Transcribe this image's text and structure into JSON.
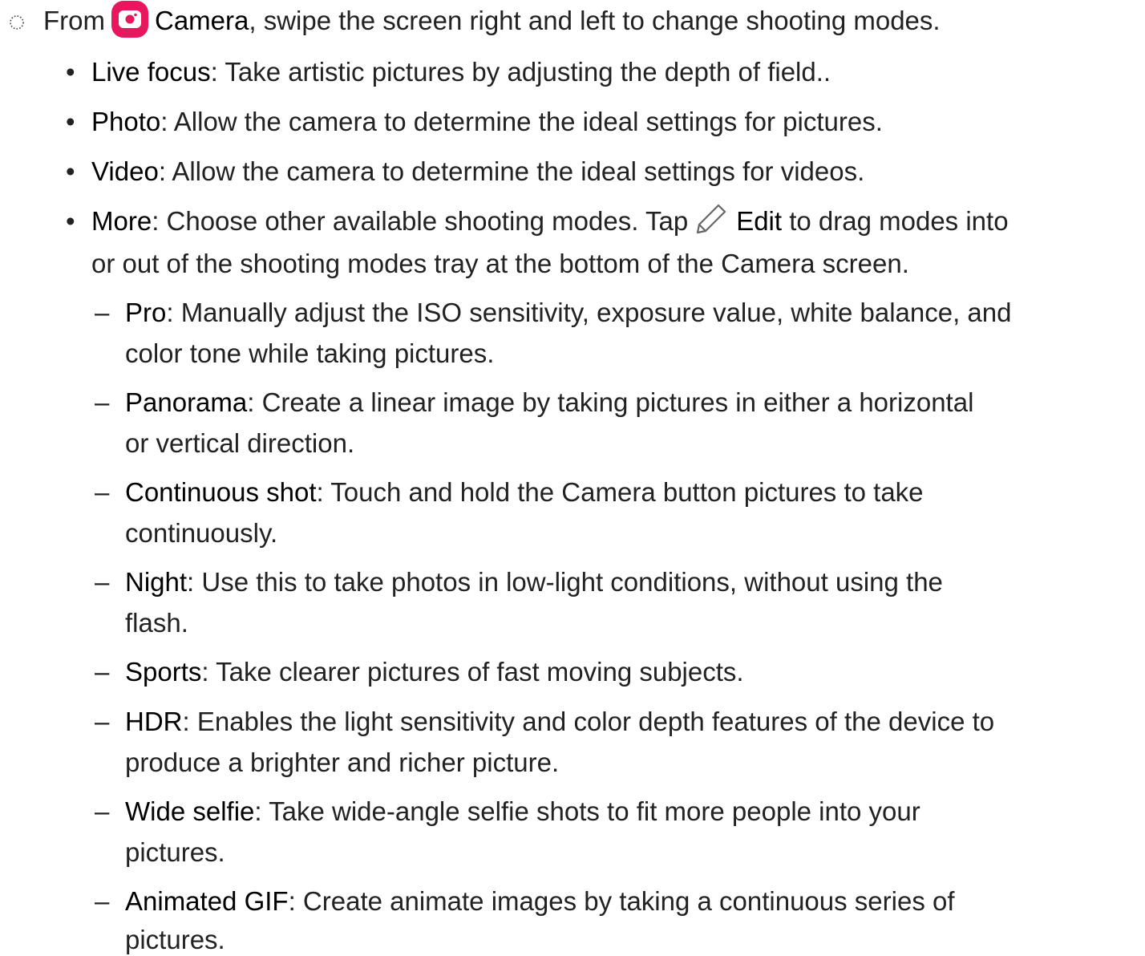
{
  "step": {
    "prefix": "From",
    "app_name": "Camera",
    "rest": ", swipe the screen right and left to change shooting modes."
  },
  "modes": [
    {
      "term": "Live focus",
      "desc": ": Take artistic pictures by adjusting the depth of field.."
    },
    {
      "term": "Photo",
      "desc": ": Allow the camera to determine the ideal settings for pictures."
    },
    {
      "term": "Video",
      "desc": ": Allow the camera to determine the ideal settings for videos."
    },
    {
      "term": "More",
      "desc_before_icon": ": Choose other available shooting modes. Tap",
      "icon_label": "Edit",
      "desc_after_icon": " to drag modes into",
      "desc_line2": "or out of the shooting modes tray at the bottom of the Camera screen."
    }
  ],
  "more_modes": [
    {
      "term": "Pro",
      "line1": ": Manually adjust the ISO sensitivity, exposure value, white balance, and",
      "line2": "color tone while taking pictures."
    },
    {
      "term": "Panorama",
      "line1": ": Create a linear image by taking pictures in either a horizontal",
      "line2": "or vertical direction."
    },
    {
      "term": "Continuous shot",
      "line1": ": Touch and hold the Camera button pictures to take",
      "line2": "continuously."
    },
    {
      "term": "Night",
      "line1": ": Use this to take photos in low-light conditions, without using the",
      "line2": "flash."
    },
    {
      "term": "Sports",
      "line1": ": Take clearer pictures of fast moving subjects.",
      "line2": ""
    },
    {
      "term": "HDR",
      "line1": ": Enables the light sensitivity and color depth features of the device to",
      "line2": "produce a brighter and richer picture."
    },
    {
      "term": "Wide selfie",
      "line1": ": Take wide-angle selfie shots to fit more people into your",
      "line2": "pictures."
    },
    {
      "term": "Animated GIF",
      "line1": ": Create animate images by taking a continuous series of",
      "line2": "pictures."
    }
  ],
  "colors": {
    "camera_icon": "#e8175d",
    "text": "#222222"
  },
  "icons": {
    "step": "dotted-circle-icon",
    "camera": "camera-app-icon",
    "edit": "pencil-icon"
  }
}
